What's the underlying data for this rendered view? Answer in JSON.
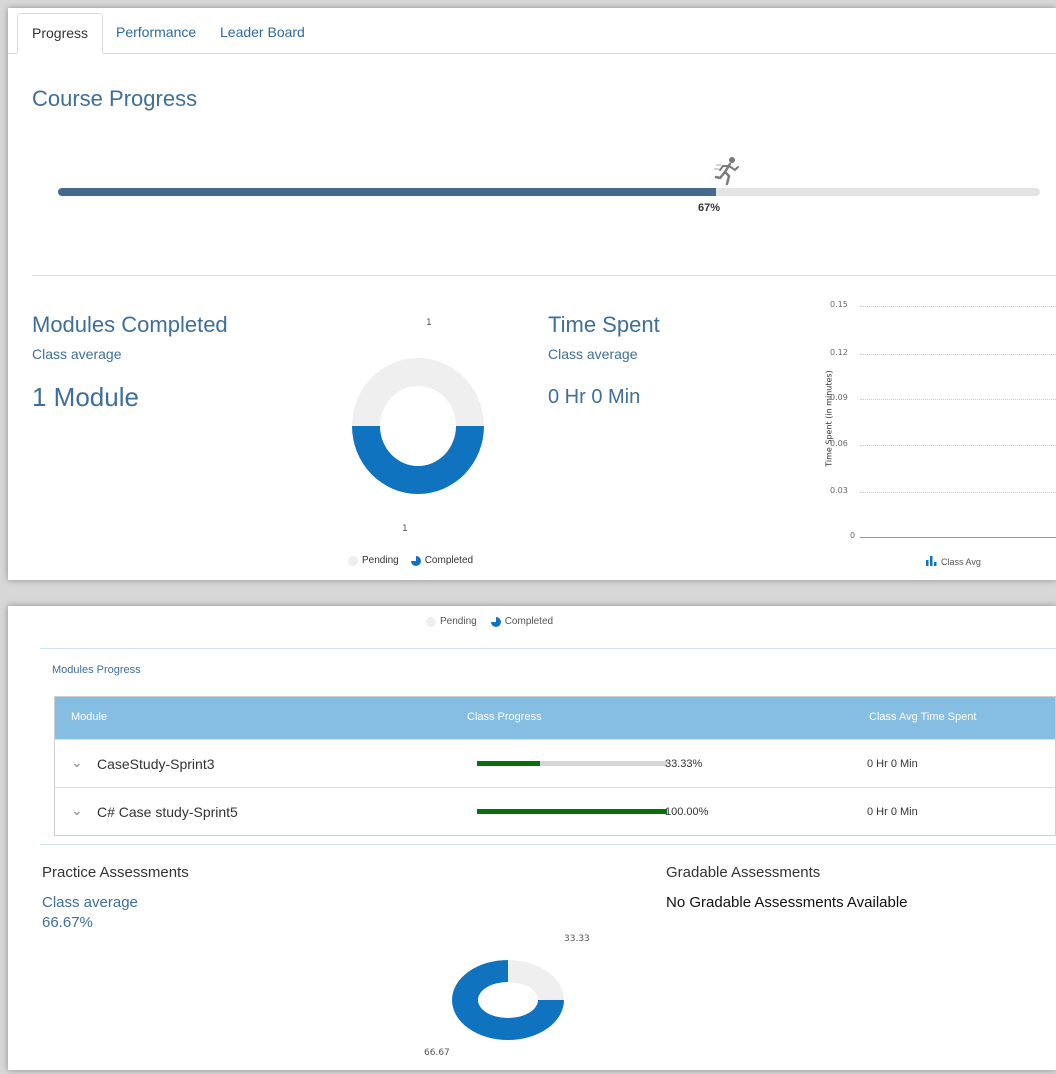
{
  "tabs": [
    "Progress",
    "Performance",
    "Leader Board"
  ],
  "course_progress": {
    "title": "Course Progress",
    "percent_label": "67%",
    "fraction": 0.67
  },
  "modules_completed": {
    "title": "Modules Completed",
    "class_average_label": "Class average",
    "value": "1 Module",
    "donut_top_label": "1",
    "donut_bottom_label": "1",
    "legend_pending": "Pending",
    "legend_completed": "Completed"
  },
  "time_spent": {
    "title": "Time Spent",
    "class_average_label": "Class average",
    "value": "0 Hr 0 Min",
    "y_axis_label": "Time Spent (in minutes)",
    "y_ticks": [
      "0.15",
      "0.12",
      "0.09",
      "0.06",
      "0.03",
      "0"
    ],
    "legend": "Class Avg"
  },
  "bottom_legend": {
    "pending": "Pending",
    "completed": "Completed"
  },
  "modules_progress": {
    "title": "Modules Progress",
    "headers": [
      "Module",
      "Class Progress",
      "Class Avg Time Spent"
    ],
    "rows": [
      {
        "module": "CaseStudy-Sprint3",
        "progress_label": "33.33%",
        "fraction": 0.3333,
        "time": "0 Hr 0 Min"
      },
      {
        "module": "C# Case study-Sprint5",
        "progress_label": "100.00%",
        "fraction": 1.0,
        "time": "0 Hr 0 Min"
      }
    ]
  },
  "practice": {
    "title": "Practice Assessments",
    "class_average_label": "Class average",
    "value": "66.67%",
    "donut_top_label": "33.33",
    "donut_bottom_label": "66.67"
  },
  "gradable": {
    "title": "Gradable Assessments",
    "message": "No Gradable Assessments Available"
  },
  "colors": {
    "blue_title": "#3f6f98",
    "donut_completed": "#0f73c0",
    "donut_pending": "#efefef",
    "table_header": "#86bde2",
    "progress_green": "#0a6e0a"
  }
}
